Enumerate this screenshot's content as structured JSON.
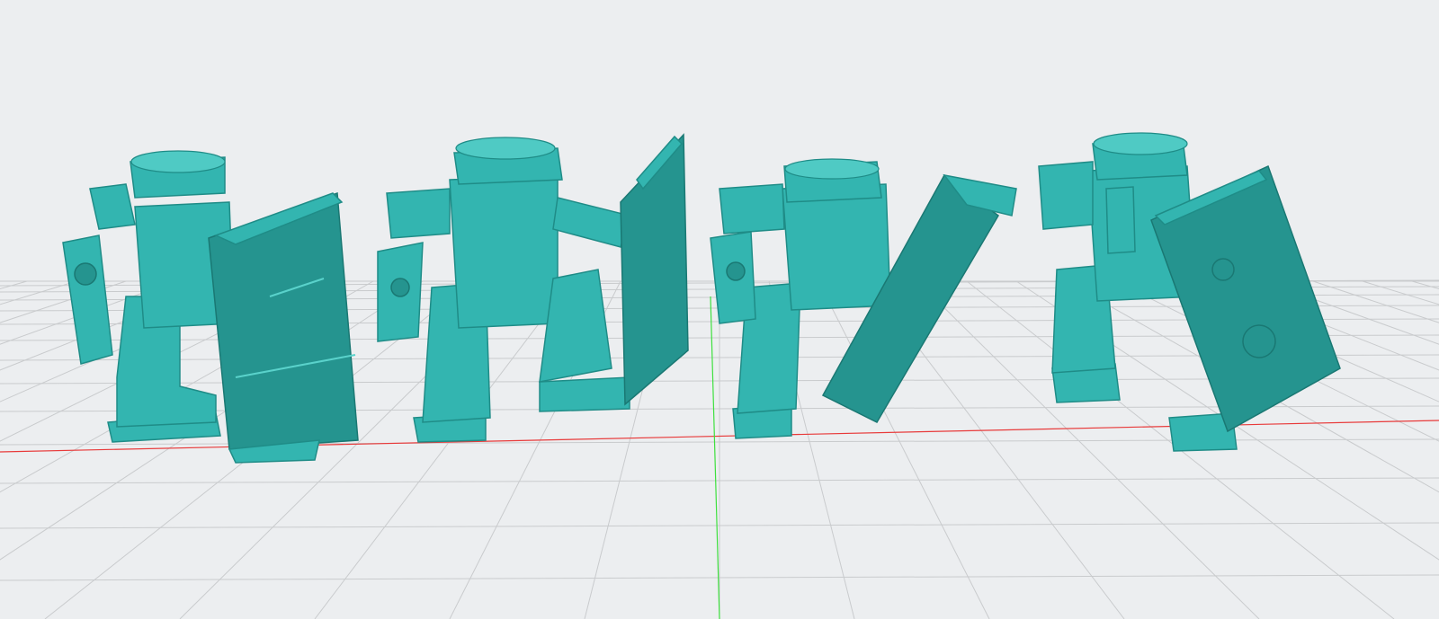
{
  "viewport": {
    "background": "#eceef0",
    "grid_color": "#c9cbcd",
    "model_color": "#33b5b0",
    "model_shadow_color": "#25948f",
    "x_axis_color": "#e83a3a",
    "y_axis_color": "#3ee03e"
  }
}
